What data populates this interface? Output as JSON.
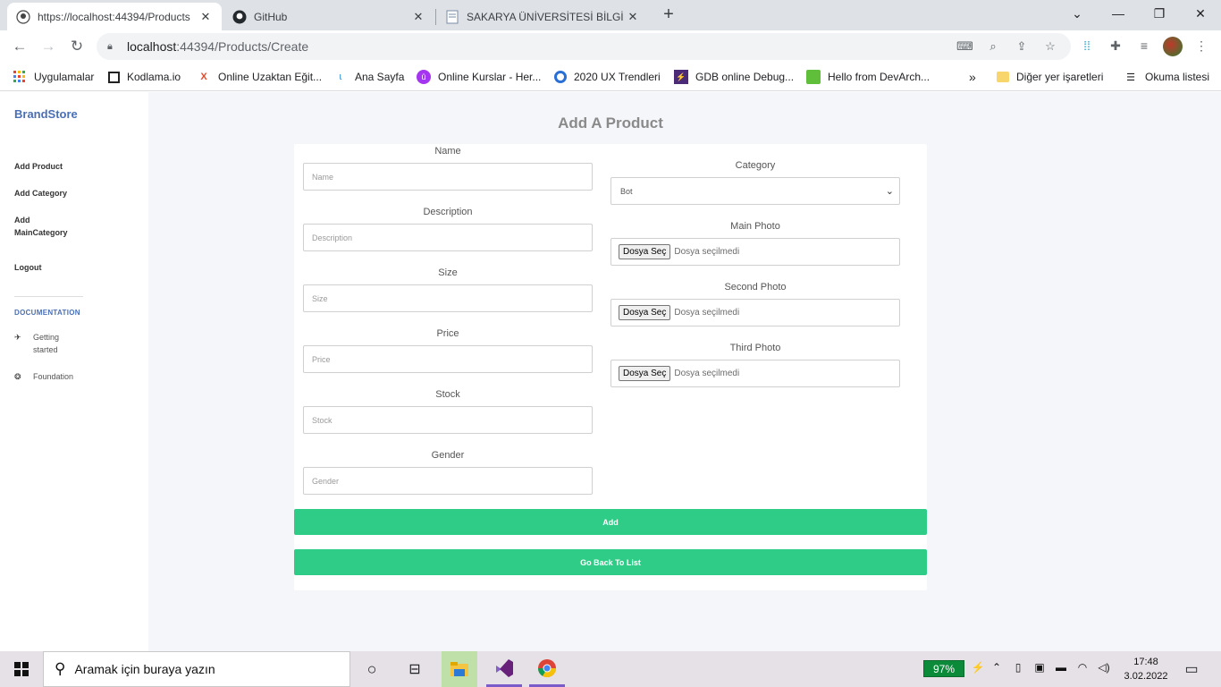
{
  "browser": {
    "tabs": [
      {
        "title": "https://localhost:44394/Products",
        "active": true
      },
      {
        "title": "GitHub",
        "active": false
      },
      {
        "title": "SAKARYA ÜNİVERSİTESİ BİLGİ SİS",
        "active": false
      }
    ],
    "url_host": "localhost",
    "url_rest": ":44394/Products/Create",
    "bookmarks": [
      {
        "label": "Uygulamalar",
        "icon": "apps-grid-icon"
      },
      {
        "label": "Kodlama.io",
        "icon": "kodlama-icon"
      },
      {
        "label": "Online Uzaktan Eğit...",
        "icon": "x-logo-icon"
      },
      {
        "label": "Ana Sayfa",
        "icon": "leaf-icon"
      },
      {
        "label": "Online Kurslar - Her...",
        "icon": "udemy-icon"
      },
      {
        "label": "2020 UX Trendleri",
        "icon": "circle-logo-icon"
      },
      {
        "label": "GDB online Debug...",
        "icon": "gdb-icon"
      },
      {
        "label": "Hello from DevArch...",
        "icon": "devarch-icon"
      }
    ],
    "bookmarks_overflow": "»",
    "bookmarks_right": [
      {
        "label": "Diğer yer işaretleri",
        "icon": "folder-icon"
      },
      {
        "label": "Okuma listesi",
        "icon": "reading-list-icon"
      }
    ]
  },
  "sidebar": {
    "brand": "BrandStore",
    "links": [
      "Add Product",
      "Add Category",
      "Add MainCategory",
      "Logout"
    ],
    "doc_title": "DOCUMENTATION",
    "doc_items": [
      "Getting started",
      "Foundation"
    ]
  },
  "form": {
    "title": "Add A Product",
    "left_fields": [
      {
        "label": "Name",
        "placeholder": "Name"
      },
      {
        "label": "Description",
        "placeholder": "Description"
      },
      {
        "label": "Size",
        "placeholder": "Size"
      },
      {
        "label": "Price",
        "placeholder": "Price"
      },
      {
        "label": "Stock",
        "placeholder": "Stock"
      },
      {
        "label": "Gender",
        "placeholder": "Gender"
      }
    ],
    "category_label": "Category",
    "category_value": "Bot",
    "file_fields": [
      {
        "label": "Main Photo"
      },
      {
        "label": "Second Photo"
      },
      {
        "label": "Third Photo"
      }
    ],
    "file_button": "Dosya Seç",
    "file_status": "Dosya seçilmedi",
    "add_button": "Add",
    "back_button": "Go Back To List"
  },
  "taskbar": {
    "search_placeholder": "Aramak için buraya yazın",
    "battery": "97%",
    "time": "17:48",
    "date": "3.02.2022"
  },
  "colors": {
    "brand": "#4a6fb5",
    "button_green": "#2ecc87",
    "page_bg": "#f5f6fa"
  }
}
